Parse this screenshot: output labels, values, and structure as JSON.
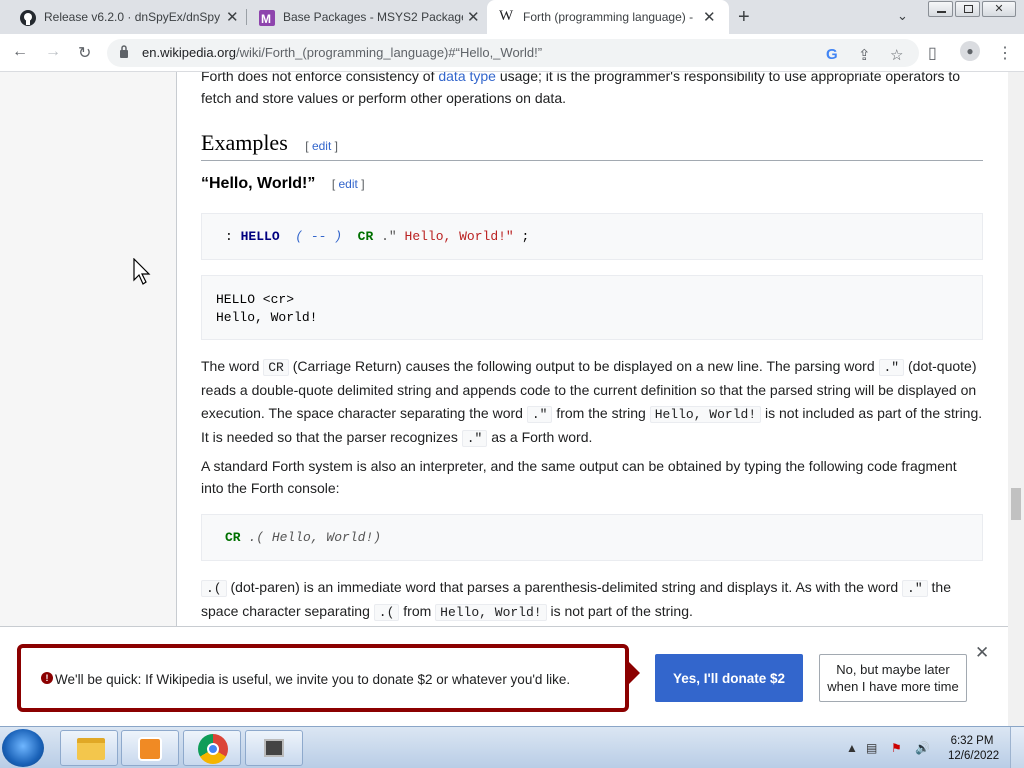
{
  "tabs": [
    {
      "title": "Release v6.2.0 · dnSpyEx/dnSpy ·",
      "icon": "github-icon"
    },
    {
      "title": "Base Packages - MSYS2 Packages",
      "icon": "msys2-icon"
    },
    {
      "title": "Forth (programming language) -",
      "icon": "wikipedia-icon"
    }
  ],
  "url": {
    "host": "en.wikipedia.org",
    "path": "/wiki/Forth_(programming_language)#“Hello,_World!”"
  },
  "article": {
    "intro_line1_pre": "Forth does not enforce consistency of ",
    "intro_link": "data type",
    "intro_line1_post": " usage; it is the programmer's responsibility to use appropriate operators to",
    "intro_line2": "fetch and store values or perform other operations on data.",
    "heading_examples": "Examples",
    "edit_label": "edit",
    "subheading": "“Hello, World!”",
    "code1": {
      "colon": ":",
      "word": "HELLO",
      "comment": "( -- )",
      "cr": "CR",
      "dot": ".\"",
      "str": "Hello, World!\"",
      "semi": ";"
    },
    "output_line1": "HELLO <cr>",
    "output_line2": "Hello, World!",
    "p1": {
      "a": "The word ",
      "code_cr": "CR",
      "b": " (Carriage Return) causes the following output to be displayed on a new line. The parsing word ",
      "code_dq": ".\"",
      "c": " (dot-quote)",
      "d": "reads a double-quote delimited string and appends code to the current definition so that the parsed string will be displayed on",
      "e": "execution. The space character separating the word ",
      "code_dq2": ".\"",
      "f": " from the string ",
      "code_hw": "Hello, World!",
      "g": " is not included as part of the string.",
      "h": "It is needed so that the parser recognizes ",
      "code_dq3": ".\"",
      "i": " as a Forth word."
    },
    "p2_line1": "A standard Forth system is also an interpreter, and the same output can be obtained by typing the following code fragment",
    "p2_line2": "into the Forth console:",
    "code2": {
      "cr": "CR",
      "rest": ".( Hello, World!)"
    },
    "p3": {
      "code_dp": ".(",
      "a": " (dot-paren) is an immediate word that parses a parenthesis-delimited string and displays it. As with the word ",
      "code_dq": ".\"",
      "b": " the",
      "c": "space character separating ",
      "code_dp2": ".(",
      "d": " from ",
      "code_hw": "Hello, World!",
      "e": " is not part of the string."
    }
  },
  "banner": {
    "message": "We'll be quick: If Wikipedia is useful, we invite you to donate $2 or whatever you'd like.",
    "yes_label": "Yes, I'll donate $2",
    "no_label": "No, but maybe later\nwhen I have more time"
  },
  "taskbar": {
    "time": "6:32 PM",
    "date": "12/6/2022"
  },
  "colors": {
    "wiki_link": "#3366cc",
    "banner_border": "#8b0000",
    "code_word": "#000080",
    "code_green": "#007000",
    "code_string": "#ba2121"
  }
}
